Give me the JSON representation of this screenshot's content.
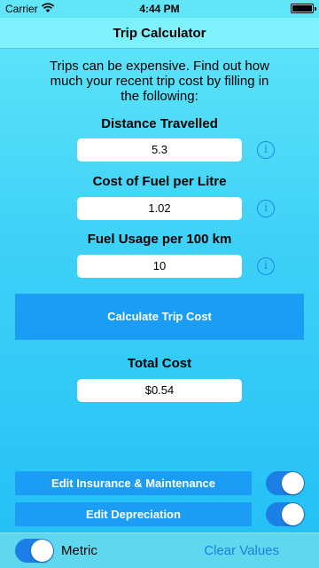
{
  "status_bar": {
    "carrier": "Carrier",
    "time": "4:44 PM"
  },
  "nav": {
    "title": "Trip Calculator"
  },
  "intro": "Trips can be expensive. Find out how much your recent trip cost by filling in the following:",
  "fields": [
    {
      "label": "Distance Travelled",
      "value": "5.3"
    },
    {
      "label": "Cost of Fuel per Litre",
      "value": "1.02"
    },
    {
      "label": "Fuel Usage per 100 km",
      "value": "10"
    }
  ],
  "info_glyph": "i",
  "calculate_label": "Calculate Trip Cost",
  "total": {
    "label": "Total Cost",
    "value": "$0.54"
  },
  "options": [
    {
      "label": "Edit Insurance & Maintenance",
      "on": true
    },
    {
      "label": "Edit Depreciation",
      "on": true
    }
  ],
  "bottom": {
    "metric_label": "Metric",
    "metric_on": true,
    "clear_label": "Clear Values"
  },
  "colors": {
    "accent": "#1B9DF6",
    "toggle_on": "#1B7FE6",
    "link": "#1F7FE0"
  }
}
